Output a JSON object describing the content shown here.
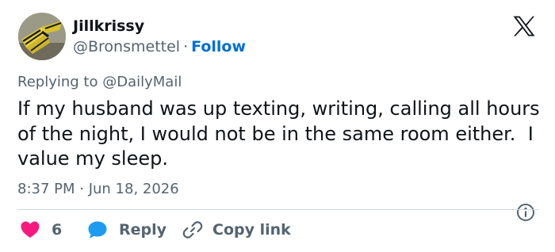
{
  "author": {
    "display_name": "Jillkrissy",
    "handle": "@Bronsmettel",
    "separator": "·",
    "follow_label": "Follow"
  },
  "replying": {
    "prefix": "Replying to",
    "mention": "@DailyMail"
  },
  "tweet": {
    "text": "If my husband was up texting, writing, calling all hours of the night, I would not be in the same room either.  I value my sleep.",
    "timestamp": "8:37 PM · Jun 18, 2026"
  },
  "actions": {
    "like_count": "6",
    "reply_label": "Reply",
    "copy_label": "Copy link"
  },
  "colors": {
    "text": "#0f1419",
    "secondary": "#536471",
    "link": "#006fd6",
    "like": "#f91880",
    "reply": "#1d9bf0",
    "divider": "#cfd9de"
  },
  "icons": {
    "brand": "x-logo-icon",
    "like": "heart-icon",
    "reply": "speech-bubble-icon",
    "copy": "link-icon",
    "info": "info-icon"
  }
}
